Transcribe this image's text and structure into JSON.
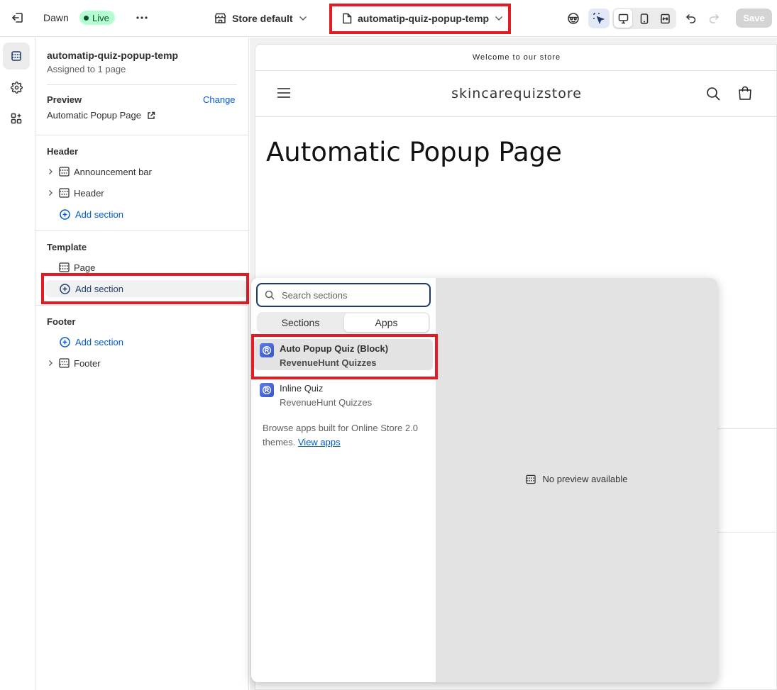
{
  "topbar": {
    "theme_name": "Dawn",
    "live_label": "Live",
    "store_label": "Store default",
    "template_label": "automatip-quiz-popup-temp",
    "save_label": "Save"
  },
  "sidebar_panel": {
    "template_title": "automatip-quiz-popup-temp",
    "assigned": "Assigned to 1 page",
    "preview_heading": "Preview",
    "change_link": "Change",
    "preview_page": "Automatic Popup Page",
    "groups": {
      "header": {
        "title": "Header",
        "items": [
          "Announcement bar",
          "Header"
        ],
        "add_section": "Add section"
      },
      "template": {
        "title": "Template",
        "items": [
          "Page"
        ],
        "add_section": "Add section"
      },
      "footer": {
        "title": "Footer",
        "add_section": "Add section",
        "items": [
          "Footer"
        ]
      }
    }
  },
  "preview": {
    "announcement": "Welcome to our store",
    "store_logo": "skincarequizstore",
    "page_heading": "Automatic Popup Page"
  },
  "popup": {
    "search_placeholder": "Search sections",
    "tabs": [
      "Sections",
      "Apps"
    ],
    "selected_tab": "Apps",
    "apps": [
      {
        "name": "Auto Popup Quiz (Block)",
        "vendor": "RevenueHunt Quizzes"
      },
      {
        "name": "Inline Quiz",
        "vendor": "RevenueHunt Quizzes"
      }
    ],
    "browse_text": "Browse apps built for Online Store 2.0 themes.",
    "view_apps_link": "View apps",
    "no_preview": "No preview available"
  },
  "colors": {
    "highlight_box": "#e31c23",
    "link": "#005bd3",
    "live_badge_bg": "#b4fed2",
    "live_badge_text": "#0c5132"
  },
  "icons": {
    "exit": "exit-icon",
    "more": "more-horizontal-icon",
    "store": "store-icon",
    "page": "page-icon",
    "sections": "sections-icon",
    "settings": "gear-icon",
    "apps": "apps-icon"
  }
}
